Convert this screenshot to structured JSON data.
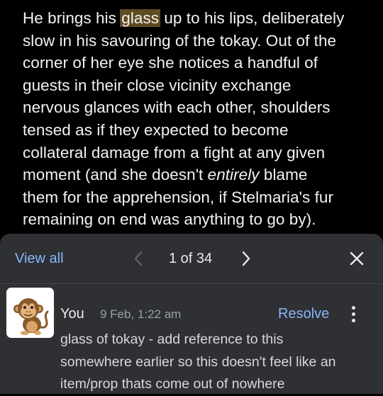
{
  "document": {
    "lines": [
      {
        "before": "He brings his ",
        "highlight": "glass",
        "after": " up to his lips, deliberately"
      },
      {
        "text": "slow in his savouring of the tokay. Out of the"
      },
      {
        "text": "corner of her eye she notices a handful of"
      },
      {
        "text": "guests in their close vicinity exchange"
      },
      {
        "text": "nervous glances with each other, shoulders"
      },
      {
        "text": "tensed as if they expected to become"
      },
      {
        "text": "collateral damage from a fight at any given"
      },
      {
        "before": "moment (and she doesn't ",
        "emphasis": "entirely",
        "after": " blame"
      },
      {
        "text": "them for the apprehension, if Stelmaria's fur"
      },
      {
        "text": "remaining on end was anything to go by)."
      }
    ],
    "highlight_color": "#5e4c23"
  },
  "comment_panel": {
    "view_all_label": "View all",
    "counter": "1 of 34",
    "prev_icon": "chevron-left-icon",
    "next_icon": "chevron-right-icon",
    "close_icon": "close-icon",
    "comment": {
      "author": "You",
      "timestamp": "9 Feb, 1:22 am",
      "resolve_label": "Resolve",
      "avatar": "monkey-avatar",
      "body_lines": [
        "glass of tokay - add reference to this",
        "somewhere earlier so this doesn't feel like an",
        "item/prop thats come out of nowhere"
      ]
    }
  },
  "colors": {
    "accent": "#8ab4f8",
    "panel": "#2e3033",
    "background": "#000000"
  }
}
